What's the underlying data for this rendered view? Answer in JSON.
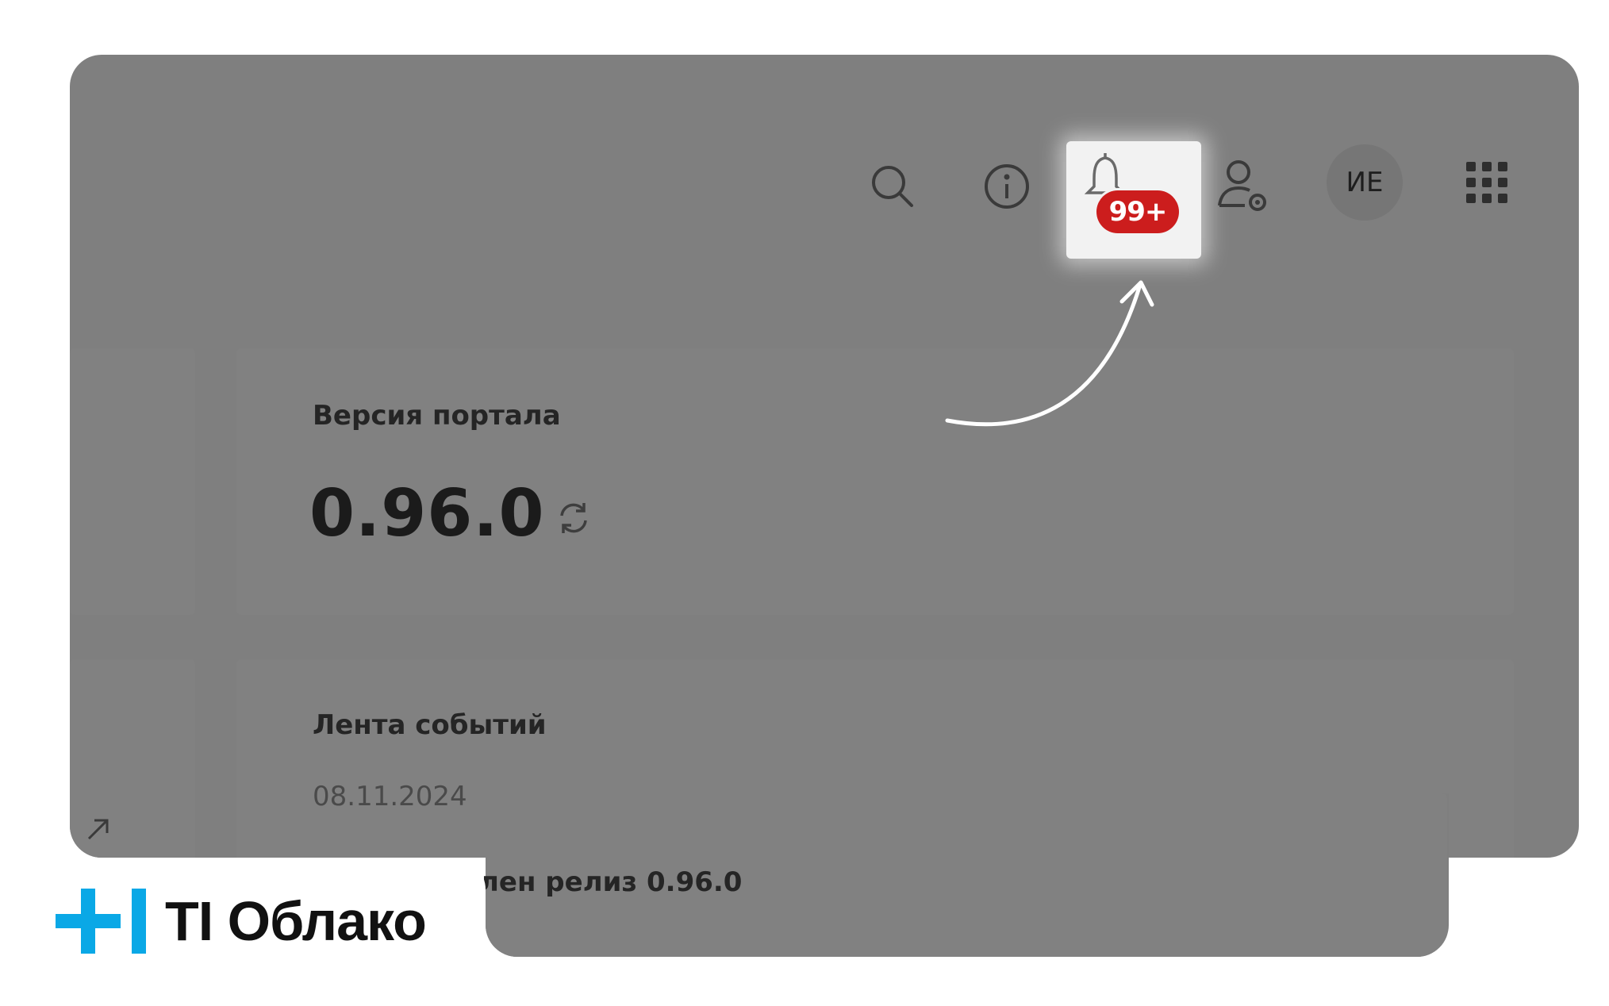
{
  "header": {
    "icons": [
      "search-icon",
      "info-icon",
      "bell-icon",
      "user-settings-icon",
      "apps-grid-icon"
    ],
    "notifications_badge": "99+",
    "avatar_initials": "ИЕ"
  },
  "portal_version_card": {
    "title": "Версия портала",
    "version": "0.96.0",
    "icon": "refresh-icon"
  },
  "events_card": {
    "title": "Лента событий",
    "date": "08.11.2024",
    "entry_text": "лен релиз 0.96.0"
  },
  "brand": {
    "logo_text": "TI Облако",
    "accent_color": "#0aa8e6"
  },
  "colors": {
    "overlay": "#7f7f7f",
    "badge": "#cc1d1d",
    "highlight": "#f2f2f2"
  }
}
